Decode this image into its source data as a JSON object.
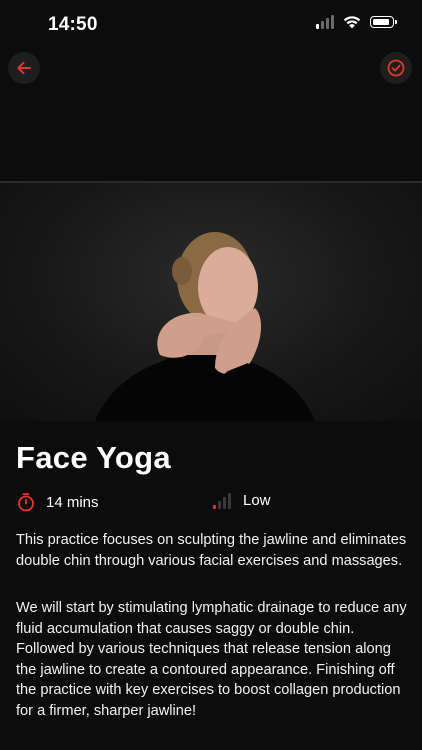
{
  "status": {
    "time": "14:50"
  },
  "colors": {
    "accent": "#e0362c",
    "background": "#0c0c0c",
    "button_bg": "#1e1e1e"
  },
  "header": {
    "back_icon": "arrow-left-icon",
    "done_icon": "check-circle-icon"
  },
  "video": {
    "description_icon": "video-frame"
  },
  "practice": {
    "title": "Face Yoga",
    "duration": "14 mins",
    "duration_icon": "stopwatch-icon",
    "level": "Low",
    "level_icon": "signal-bars-icon",
    "level_bars_active": 1,
    "level_bars_total": 4,
    "description_1": "This practice focuses on sculpting the jawline and eliminates double chin through various facial exercises and massages.",
    "description_2": "We will start by stimulating lymphatic drainage to reduce any fluid accumulation that causes saggy or double chin. Followed by various techniques that release tension along the jawline to create a contoured appearance. Finishing off the practice with key exercises to boost collagen production for a firmer, sharper jawline!"
  }
}
